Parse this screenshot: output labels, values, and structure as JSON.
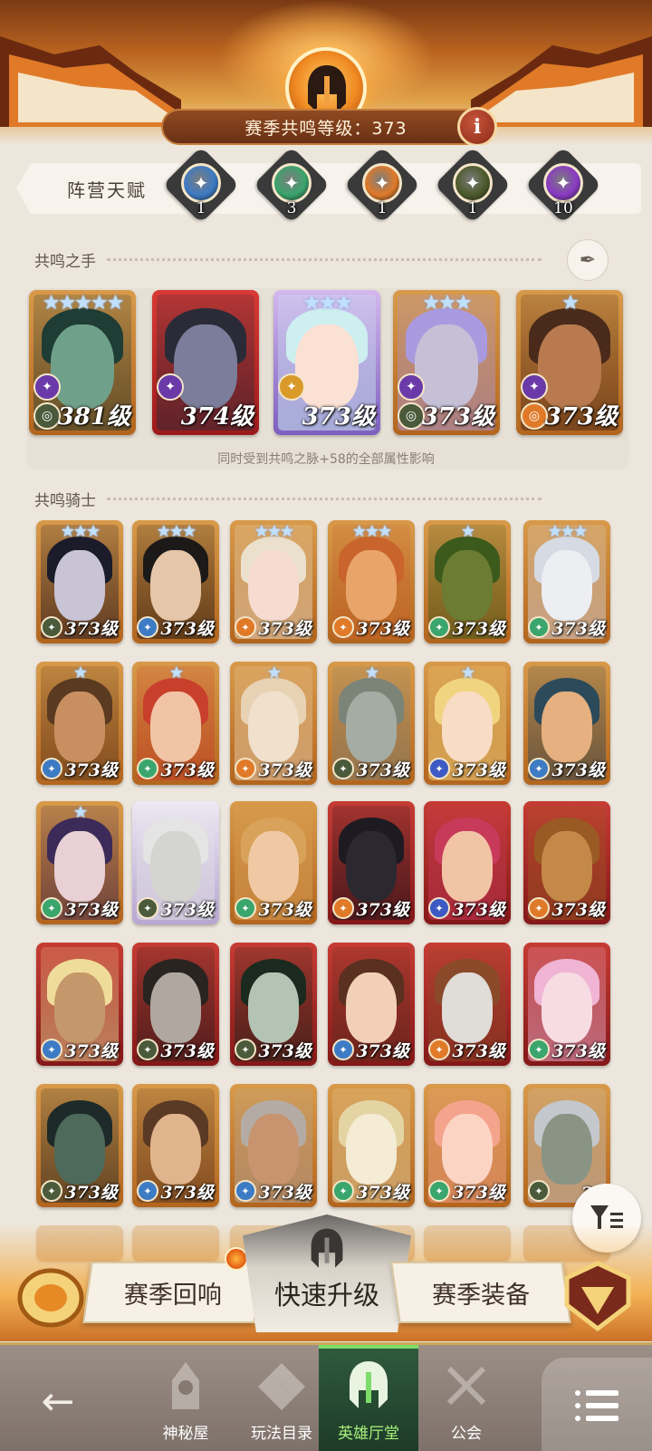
{
  "header": {
    "level_text": "赛季共鸣等级：373",
    "info_label": "i"
  },
  "faction_talent": {
    "label": "阵营天赋",
    "items": [
      {
        "icon": "lightbearer-star-icon",
        "count": "1",
        "color": "#3d7bc4"
      },
      {
        "icon": "wilder-leaf-icon",
        "count": "3",
        "color": "#3aa56c"
      },
      {
        "icon": "graveborn-icon",
        "count": "1",
        "color": "#e07a28"
      },
      {
        "icon": "mauler-eye-icon",
        "count": "1",
        "color": "#4c5a2a"
      },
      {
        "icon": "celestial-hypogean-icon",
        "count": "10",
        "color": "#8a3ac4"
      }
    ]
  },
  "resonance_hand": {
    "title": "共鸣之手",
    "caption": "同时受到共鸣之脉+58的全部属性影响",
    "heroes": [
      {
        "level": "381级",
        "stars": "★★★★★",
        "bg": "bg-gold",
        "hair": "#1f3d34",
        "skin": "#6fa08a",
        "badge_color": "#6a3aa8",
        "badge2_color": "#4a5a3a"
      },
      {
        "level": "374级",
        "stars": "",
        "bg": "bg-red",
        "hair": "#2b2b38",
        "skin": "#7b7d9a",
        "badge_color": "#6a3aa8",
        "badge2_color": ""
      },
      {
        "level": "373级",
        "stars": "★★★",
        "bg": "bg-pastel",
        "hair": "#cdeff0",
        "skin": "#fbe0d4",
        "badge_color": "#d99a2a",
        "badge2_color": "",
        "pastel": true
      },
      {
        "level": "373级",
        "stars": "★★★",
        "bg": "bg-gold",
        "hair": "#a99ae0",
        "skin": "#c5c0d6",
        "badge_color": "#6a3aa8",
        "badge2_color": "#4a5a3a"
      },
      {
        "level": "373级",
        "stars": "★",
        "bg": "bg-gold",
        "hair": "#4a2a1a",
        "skin": "#b87a4e",
        "badge_color": "#6a3aa8",
        "badge2_color": "#e07a28"
      }
    ]
  },
  "resonance_knights": {
    "title": "共鸣骑士",
    "rows": [
      [
        {
          "level": "373级",
          "stars": "★★★",
          "bg": "bg-gold",
          "hair": "#1b1b2a",
          "skin": "#c8c4d6",
          "badge_color": "#4a5a3a"
        },
        {
          "level": "373级",
          "stars": "★★★",
          "bg": "bg-gold",
          "hair": "#1c1a18",
          "skin": "#e6c6a8",
          "badge_color": "#3d7bc4"
        },
        {
          "level": "373级",
          "stars": "★★★",
          "bg": "bg-gold",
          "hair": "#eae0cc",
          "skin": "#f6dcd0",
          "badge_color": "#e07a28"
        },
        {
          "level": "373级",
          "stars": "★★★",
          "bg": "bg-gold",
          "hair": "#c8642c",
          "skin": "#e9a46a",
          "badge_color": "#e07a28"
        },
        {
          "level": "373级",
          "stars": "★",
          "bg": "bg-gold",
          "hair": "#3b5a1c",
          "skin": "#6c7c32",
          "badge_color": "#3aa56c"
        },
        {
          "level": "373级",
          "stars": "★★★",
          "bg": "bg-gold",
          "hair": "#d6dae2",
          "skin": "#eceef2",
          "badge_color": "#3aa56c"
        }
      ],
      [
        {
          "level": "373级",
          "stars": "★",
          "bg": "bg-gold",
          "hair": "#5a3a20",
          "skin": "#c89060",
          "badge_color": "#3d7bc4"
        },
        {
          "level": "373级",
          "stars": "★",
          "bg": "bg-gold",
          "hair": "#c8402c",
          "skin": "#f2c4a6",
          "badge_color": "#3aa56c"
        },
        {
          "level": "373级",
          "stars": "★",
          "bg": "bg-gold",
          "hair": "#e8d2b4",
          "skin": "#f0e0cc",
          "badge_color": "#e07a28"
        },
        {
          "level": "373级",
          "stars": "★",
          "bg": "bg-gold",
          "hair": "#7c8478",
          "skin": "#a4aca4",
          "badge_color": "#4a5a3a"
        },
        {
          "level": "373级",
          "stars": "★",
          "bg": "bg-gold",
          "hair": "#f0d480",
          "skin": "#f9dcc4",
          "badge_color": "#3d5ac4"
        },
        {
          "level": "373级",
          "stars": "",
          "bg": "bg-gold",
          "hair": "#2c4a5a",
          "skin": "#e6b080",
          "badge_color": "#3d7bc4"
        }
      ],
      [
        {
          "level": "373级",
          "stars": "★",
          "bg": "bg-gold",
          "hair": "#3c2a58",
          "skin": "#e8d0d4",
          "badge_color": "#3aa56c"
        },
        {
          "level": "373级",
          "stars": "",
          "bg": "bg-white",
          "hair": "#e4e4e4",
          "skin": "#d4d4d0",
          "badge_color": "#4a5a3a"
        },
        {
          "level": "373级",
          "stars": "",
          "bg": "bg-gold",
          "hair": "#d8a25a",
          "skin": "#f0c8a4",
          "badge_color": "#3aa56c"
        },
        {
          "level": "373级",
          "stars": "",
          "bg": "bg-darkred",
          "hair": "#1e1a22",
          "skin": "#2c2830",
          "badge_color": "#e07a28"
        },
        {
          "level": "373级",
          "stars": "",
          "bg": "bg-darkred",
          "hair": "#c83a5a",
          "skin": "#f2c4a6",
          "badge_color": "#3d5ac4"
        },
        {
          "level": "373级",
          "stars": "",
          "bg": "bg-darkred",
          "hair": "#9a5a24",
          "skin": "#c48848",
          "badge_color": "#e07a28"
        }
      ],
      [
        {
          "level": "373级",
          "stars": "",
          "bg": "bg-darkred",
          "hair": "#f0dc9a",
          "skin": "#c4986a",
          "badge_color": "#3d7bc4"
        },
        {
          "level": "373级",
          "stars": "",
          "bg": "bg-darkred",
          "hair": "#2a2420",
          "skin": "#b0a8a0",
          "badge_color": "#4a5a3a"
        },
        {
          "level": "373级",
          "stars": "",
          "bg": "bg-darkred",
          "hair": "#1a2a1e",
          "skin": "#b4c4b4",
          "badge_color": "#4a5a3a"
        },
        {
          "level": "373级",
          "stars": "",
          "bg": "bg-darkred",
          "hair": "#5a3020",
          "skin": "#f2d0b8",
          "badge_color": "#3d7bc4"
        },
        {
          "level": "373级",
          "stars": "",
          "bg": "bg-darkred",
          "hair": "#8a4a2a",
          "skin": "#e0dcd8",
          "badge_color": "#e07a28"
        },
        {
          "level": "373级",
          "stars": "",
          "bg": "bg-darkred",
          "hair": "#f0b4d4",
          "skin": "#f8dce4",
          "badge_color": "#3aa56c"
        }
      ],
      [
        {
          "level": "373级",
          "stars": "",
          "bg": "bg-gold",
          "hair": "#1e2a2a",
          "skin": "#4e6a5a",
          "badge_color": "#4a5a3a"
        },
        {
          "level": "373级",
          "stars": "",
          "bg": "bg-gold",
          "hair": "#5a3a24",
          "skin": "#e0b48c",
          "badge_color": "#3d7bc4"
        },
        {
          "level": "373级",
          "stars": "",
          "bg": "bg-gold",
          "hair": "#b4aca4",
          "skin": "#c89470",
          "badge_color": "#3d7bc4"
        },
        {
          "level": "373级",
          "stars": "",
          "bg": "bg-gold",
          "hair": "#e4d4a4",
          "skin": "#f4ecd4",
          "badge_color": "#3aa56c"
        },
        {
          "level": "373级",
          "stars": "",
          "bg": "bg-gold",
          "hair": "#f4a48c",
          "skin": "#fbd4c4",
          "badge_color": "#3aa56c"
        },
        {
          "level": "37",
          "stars": "",
          "bg": "bg-gold",
          "hair": "#c4c8cc",
          "skin": "#8a9484",
          "badge_color": "#4a5a3a"
        }
      ]
    ]
  },
  "action_bar": {
    "season_echo_label": "赛季回响",
    "quick_upgrade_label": "快速升级",
    "season_gear_label": "赛季装备"
  },
  "bottom_nav": {
    "back_icon": "arrow-left-icon",
    "items": [
      {
        "label": "神秘屋",
        "icon": "mystery-house-icon"
      },
      {
        "label": "玩法目录",
        "icon": "game-modes-icon"
      },
      {
        "label": "英雄厅堂",
        "icon": "hero-hall-icon",
        "active": true
      },
      {
        "label": "公会",
        "icon": "guild-icon"
      }
    ],
    "menu_icon": "menu-list-icon"
  }
}
